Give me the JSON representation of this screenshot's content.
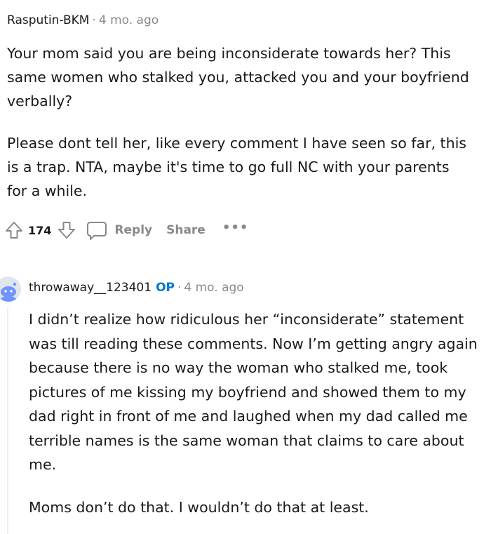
{
  "top_comment": {
    "author": "Rasputin-BKM",
    "separator": "·",
    "age": "4 mo. ago",
    "paragraphs": [
      "Your mom said you are being inconsiderate towards her? This same women who stalked you, attacked you and your boyfriend verbally?",
      "Please dont tell her, like every comment I have seen so far, this is a trap. NTA, maybe it's time to go full NC with your parents for a while."
    ],
    "actions": {
      "upvote_icon": "arrow-up-outline-icon",
      "vote_count": "174",
      "downvote_icon": "arrow-down-outline-icon",
      "reply_icon": "speech-bubble-icon",
      "reply_label": "Reply",
      "share_label": "Share",
      "more_label": "•••"
    }
  },
  "reply": {
    "avatar_icon": "snoo-avatar-icon",
    "author": "throwaway__123401",
    "op_badge": "OP",
    "separator": "·",
    "age": "4 mo. ago",
    "paragraphs": [
      "I didn’t realize how ridiculous her “inconsiderate” statement was till reading these comments. Now I’m getting angry again because there is no way the woman who stalked me, took pictures of me kissing my boyfriend and showed them to my dad right in front of me and laughed when my dad called me terrible names is the same woman that claims to care about me.",
      "Moms don’t do that. I wouldn’t do that at least."
    ]
  },
  "colors": {
    "text": "#1a1a1b",
    "meta": "#878a8c",
    "op_blue": "#0079d3",
    "thread_line": "#edeff1"
  }
}
